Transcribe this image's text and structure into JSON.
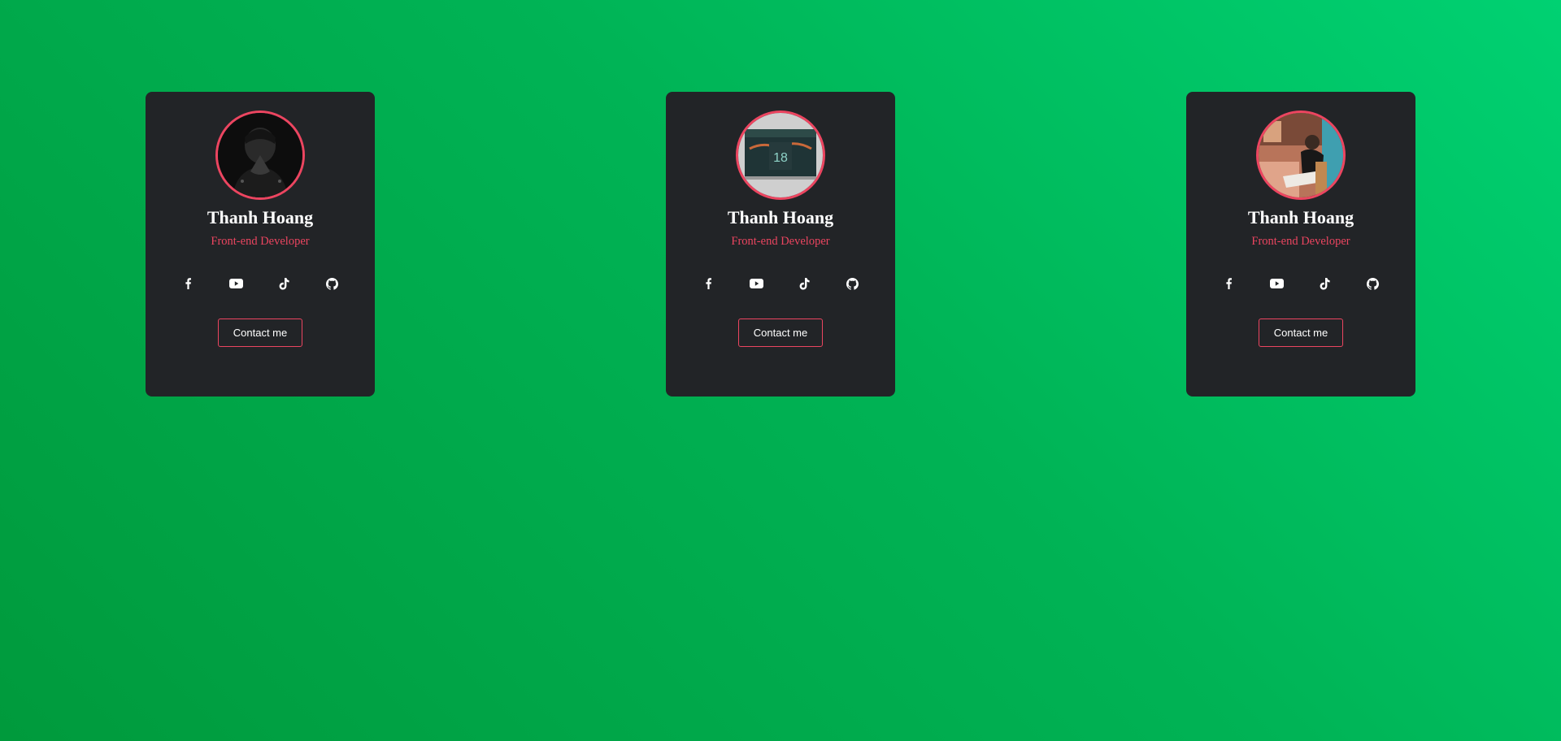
{
  "colors": {
    "accent": "#ec4560",
    "card_background": "#222427",
    "page_gradient_light": "#00d172",
    "page_gradient_dark": "#009a3c"
  },
  "cards": [
    {
      "avatar": "profile-photo-dark-portrait",
      "name": "Thanh Hoang",
      "role": "Front-end Developer",
      "socials": [
        "facebook-icon",
        "youtube-icon",
        "tiktok-icon",
        "github-icon"
      ],
      "button_label": "Contact me"
    },
    {
      "avatar": "profile-photo-jersey-18",
      "name": "Thanh Hoang",
      "role": "Front-end Developer",
      "socials": [
        "facebook-icon",
        "youtube-icon",
        "tiktok-icon",
        "github-icon"
      ],
      "button_label": "Contact me"
    },
    {
      "avatar": "profile-photo-cafe",
      "name": "Thanh Hoang",
      "role": "Front-end Developer",
      "socials": [
        "facebook-icon",
        "youtube-icon",
        "tiktok-icon",
        "github-icon"
      ],
      "button_label": "Contact me"
    }
  ]
}
